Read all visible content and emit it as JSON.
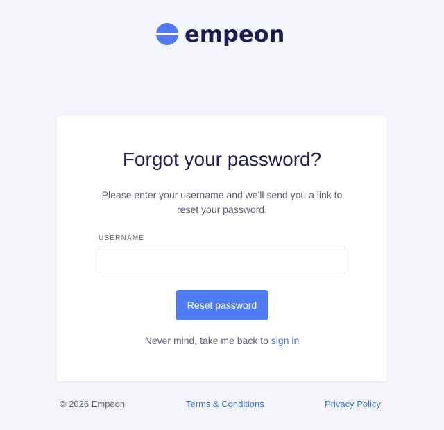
{
  "brand": {
    "name": "empeon",
    "logo_icon": "empeon-logo-icon",
    "text_color": "#1d1b4f",
    "accent_color": "#4f7cf6"
  },
  "card": {
    "title": "Forgot your password?",
    "description": "Please enter your username and we'll send you a link to reset your password.",
    "username_label": "USERNAME",
    "username_value": "",
    "username_placeholder": "",
    "reset_button_label": "Reset password",
    "back_text": "Never mind, take me back to",
    "back_link_label": "sign in"
  },
  "footer": {
    "copyright": "© 2026 Empeon",
    "terms_label": "Terms & Conditions",
    "privacy_label": "Privacy Policy",
    "link_color": "#3f73e0"
  }
}
